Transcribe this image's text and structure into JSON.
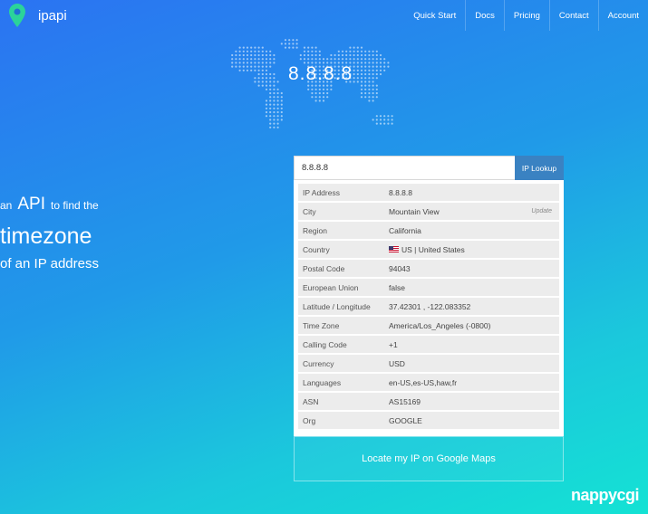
{
  "brand": {
    "name": "ipapi"
  },
  "nav": [
    {
      "label": "Quick Start"
    },
    {
      "label": "Docs"
    },
    {
      "label": "Pricing"
    },
    {
      "label": "Contact"
    },
    {
      "label": "Account"
    }
  ],
  "hero": {
    "ip_display": "8.8.8.8"
  },
  "tagline": {
    "prefix": "an",
    "api": "API",
    "suffix": "to find the",
    "timezone": "timezone",
    "line3": "of an IP address"
  },
  "search": {
    "value": "8.8.8.8",
    "button_label": "IP Lookup"
  },
  "results": [
    {
      "key": "IP Address",
      "value": "8.8.8.8"
    },
    {
      "key": "City",
      "value": "Mountain View",
      "action": "Update"
    },
    {
      "key": "Region",
      "value": "California"
    },
    {
      "key": "Country",
      "value": "US | United States",
      "flag": "us-flag-icon"
    },
    {
      "key": "Postal Code",
      "value": "94043"
    },
    {
      "key": "European Union",
      "value": "false"
    },
    {
      "key": "Latitude / Longitude",
      "value": "37.42301 , -122.083352"
    },
    {
      "key": "Time Zone",
      "value": "America/Los_Angeles (-0800)"
    },
    {
      "key": "Calling Code",
      "value": "+1"
    },
    {
      "key": "Currency",
      "value": "USD"
    },
    {
      "key": "Languages",
      "value": "en-US,es-US,haw,fr"
    },
    {
      "key": "ASN",
      "value": "AS15169"
    },
    {
      "key": "Org",
      "value": "GOOGLE"
    }
  ],
  "locate_button": "Locate my IP on Google Maps",
  "watermark": "nappycgi",
  "colors": {
    "accent": "#3a82c2",
    "background_start": "#2b73f2",
    "background_end": "#14e2d4"
  }
}
